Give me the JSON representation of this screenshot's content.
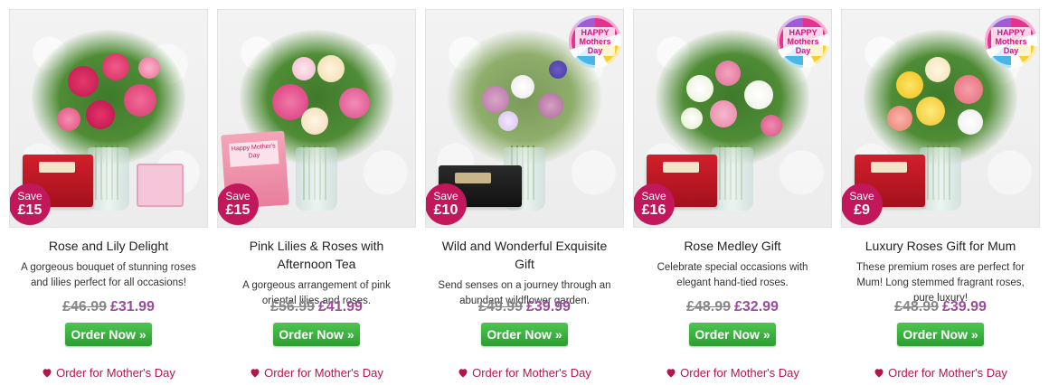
{
  "products": [
    {
      "title": "Rose and Lily Delight",
      "description": "A gorgeous bouquet of stunning roses and lilies perfect for all occasions!",
      "save_label": "Save",
      "save_amount": "£15",
      "was_price": "£46.99",
      "price": "£31.99",
      "button_label": "Order Now »",
      "link_label": "Order for Mother's Day",
      "has_balloon": false,
      "extras": [
        "gift-box-red",
        "card"
      ]
    },
    {
      "title": "Pink Lilies & Roses with Afternoon Tea",
      "description": "A gorgeous arrangement of pink oriental lilies and roses.",
      "save_label": "Save",
      "save_amount": "£15",
      "was_price": "£56.99",
      "price": "£41.99",
      "button_label": "Order Now »",
      "link_label": "Order for Mother's Day",
      "has_balloon": false,
      "tea_box_text": "Happy Mother's Day",
      "extras": [
        "tea-box"
      ]
    },
    {
      "title": "Wild and Wonderful Exquisite Gift",
      "description": "Send senses on a journey through an abundant wildflower garden.",
      "save_label": "Save",
      "save_amount": "£10",
      "was_price": "£49.99",
      "price": "£39.99",
      "button_label": "Order Now »",
      "link_label": "Order for Mother's Day",
      "has_balloon": true,
      "balloon_text": "HAPPY Mothers Day",
      "extras": [
        "gift-box-dark"
      ]
    },
    {
      "title": "Rose Medley Gift",
      "description": "Celebrate special occasions with elegant hand-tied roses.",
      "save_label": "Save",
      "save_amount": "£16",
      "was_price": "£48.99",
      "price": "£32.99",
      "button_label": "Order Now »",
      "link_label": "Order for Mother's Day",
      "has_balloon": true,
      "balloon_text": "HAPPY Mothers Day",
      "extras": [
        "gift-box-red"
      ]
    },
    {
      "title": "Luxury Roses Gift for Mum",
      "description": "These premium roses are perfect for Mum! Long stemmed fragrant roses, pure luxury!",
      "save_label": "Save",
      "save_amount": "£9",
      "was_price": "£48.99",
      "price": "£39.99",
      "button_label": "Order Now »",
      "link_label": "Order for Mother's Day",
      "has_balloon": true,
      "balloon_text": "HAPPY Mothers Day",
      "extras": [
        "gift-box-red"
      ]
    }
  ],
  "colors": {
    "badge": "#c2185b",
    "price_now": "#9c4a9c",
    "button": "#3fb543",
    "link": "#b3164f"
  },
  "icons": {
    "link_icon": "heart-icon"
  }
}
